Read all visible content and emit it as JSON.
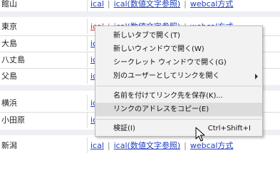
{
  "table": {
    "top_row": {
      "city": "館山",
      "links": {
        "ical": "ical",
        "ical_numeric": "ical(数値文字参照)",
        "webcal": "webcal方式"
      }
    },
    "rows": [
      {
        "city": "東京",
        "links": {
          "ical": "ical",
          "ical_numeric": "ical(数値文字参照)",
          "webcal": "webcal方式"
        }
      },
      {
        "city": "大島",
        "links": {
          "ical": "ic"
        }
      },
      {
        "city": "八丈島",
        "links": {
          "ical": "ic"
        }
      },
      {
        "city": "父島",
        "links": {
          "ical": "ic"
        }
      }
    ],
    "rows2": [
      {
        "city": "横浜",
        "links": {
          "ical": "ic"
        }
      },
      {
        "city": "小田原",
        "links": {
          "ical": "ic"
        }
      }
    ],
    "bottom_row": {
      "city": "新潟",
      "links": {
        "ical": "ical",
        "ical_numeric": "ical(数値文字参照)",
        "webcal": "webcal方式"
      }
    },
    "separator": "|"
  },
  "context_menu": {
    "items": [
      {
        "label": "新しいタブで開く(T)"
      },
      {
        "label": "新しいウィンドウで開く(W)"
      },
      {
        "label": "シークレット ウィンドウで開く(G)"
      },
      {
        "label": "別のユーザーとしてリンクを開く",
        "submenu": true
      },
      {
        "label": "名前を付けてリンク先を保存(K)..."
      },
      {
        "label": "リンクのアドレスをコピー(E)",
        "highlighted": true
      },
      {
        "label": "検証(I)",
        "shortcut": "Ctrl+Shift+I"
      }
    ]
  },
  "colors": {
    "link": "#1f3fbf",
    "visited_link": "#c03030",
    "menu_bg": "#f2f2f2",
    "menu_highlight": "#dcdcdc",
    "separator_band": "#eef0f4"
  },
  "cursor": {
    "icon": "arrow-cursor-icon"
  }
}
